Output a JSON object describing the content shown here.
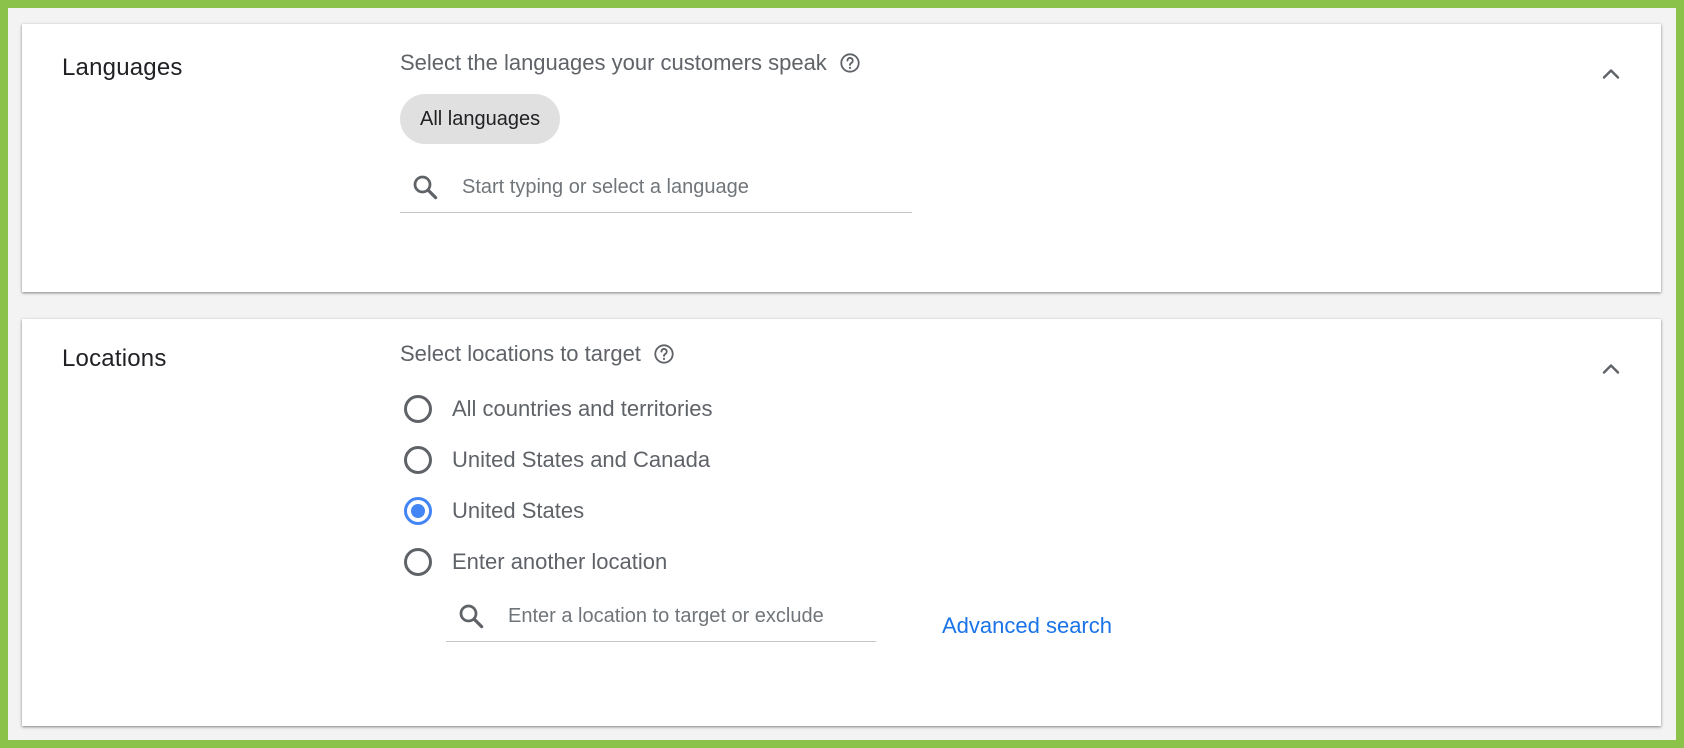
{
  "languages": {
    "title": "Languages",
    "prompt": "Select the languages your customers speak",
    "chip_label": "All languages",
    "search_placeholder": "Start typing or select a language"
  },
  "locations": {
    "title": "Locations",
    "prompt": "Select locations to target",
    "options": [
      {
        "label": "All countries and territories",
        "checked": false
      },
      {
        "label": "United States and Canada",
        "checked": false
      },
      {
        "label": "United States",
        "checked": true
      },
      {
        "label": "Enter another location",
        "checked": false
      }
    ],
    "search_placeholder": "Enter a location to target or exclude",
    "advanced_search_label": "Advanced search"
  },
  "icons": {
    "help": "help-circle-icon",
    "collapse": "chevron-up-icon",
    "search": "search-icon"
  },
  "colors": {
    "frame_border": "#8bc34a",
    "radio_selected": "#4285f4",
    "link": "#1a73e8"
  }
}
